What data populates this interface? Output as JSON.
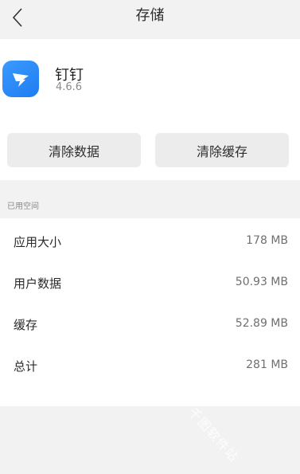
{
  "header": {
    "title": "存储"
  },
  "app": {
    "name": "钉钉",
    "version": "4.6.6"
  },
  "actions": {
    "clear_data": "清除数据",
    "clear_cache": "清除缓存"
  },
  "section": {
    "label": "已用空间"
  },
  "storage": [
    {
      "label": "应用大小",
      "value": "178 MB"
    },
    {
      "label": "用户数据",
      "value": "50.93 MB"
    },
    {
      "label": "缓存",
      "value": "52.89 MB"
    },
    {
      "label": "总计",
      "value": "281 MB"
    }
  ],
  "watermark": "千图软件站",
  "colors": {
    "app_icon": "#1f7cf0",
    "button_bg": "#ececec",
    "page_bg": "#f2f2f2"
  }
}
